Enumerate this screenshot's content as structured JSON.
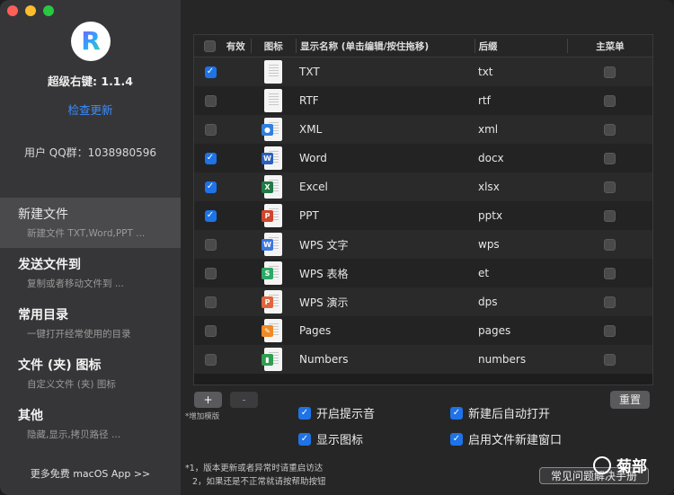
{
  "window": {
    "buttons": [
      "close",
      "minimize",
      "zoom"
    ]
  },
  "sidebar": {
    "logo_letter": "R",
    "app_version": "超级右键: 1.1.4",
    "check_update": "检查更新",
    "qq_group": "用户 QQ群：1038980596",
    "nav": [
      {
        "title": "新建文件",
        "subtitle": "新建文件 TXT,Word,PPT ...",
        "active": true
      },
      {
        "title": "发送文件到",
        "subtitle": "复制或者移动文件到 ...",
        "active": false
      },
      {
        "title": "常用目录",
        "subtitle": "一键打开经常使用的目录",
        "active": false
      },
      {
        "title": "文件 (夹) 图标",
        "subtitle": "自定义文件 (夹) 图标",
        "active": false
      },
      {
        "title": "其他",
        "subtitle": "隐藏,显示,拷贝路径 ...",
        "active": false
      }
    ],
    "more_apps": "更多免费 macOS App >>"
  },
  "table": {
    "headers": {
      "enabled": "有效",
      "icon": "图标",
      "name": "显示名称 (单击编辑/按住拖移)",
      "suffix": "后缀",
      "main_menu": "主菜单"
    },
    "rows": [
      {
        "enabled": true,
        "name": "TXT",
        "suffix": "txt",
        "icon": "txt-file-icon",
        "badge": "",
        "badge_color": ""
      },
      {
        "enabled": false,
        "name": "RTF",
        "suffix": "rtf",
        "icon": "rtf-file-icon",
        "badge": "",
        "badge_color": ""
      },
      {
        "enabled": false,
        "name": "XML",
        "suffix": "xml",
        "icon": "xml-file-icon",
        "badge": "●",
        "badge_color": "#2f7fe0"
      },
      {
        "enabled": true,
        "name": "Word",
        "suffix": "docx",
        "icon": "word-file-icon",
        "badge": "W",
        "badge_color": "#2b5fbf"
      },
      {
        "enabled": true,
        "name": "Excel",
        "suffix": "xlsx",
        "icon": "excel-file-icon",
        "badge": "X",
        "badge_color": "#1f7a45"
      },
      {
        "enabled": true,
        "name": "PPT",
        "suffix": "pptx",
        "icon": "ppt-file-icon",
        "badge": "P",
        "badge_color": "#d0452c"
      },
      {
        "enabled": false,
        "name": "WPS 文字",
        "suffix": "wps",
        "icon": "wps-writer-icon",
        "badge": "W",
        "badge_color": "#3b77e0"
      },
      {
        "enabled": false,
        "name": "WPS 表格",
        "suffix": "et",
        "icon": "wps-sheet-icon",
        "badge": "S",
        "badge_color": "#2da866"
      },
      {
        "enabled": false,
        "name": "WPS 演示",
        "suffix": "dps",
        "icon": "wps-slides-icon",
        "badge": "P",
        "badge_color": "#e0653a"
      },
      {
        "enabled": false,
        "name": "Pages",
        "suffix": "pages",
        "icon": "pages-file-icon",
        "badge": "✎",
        "badge_color": "#f08a24"
      },
      {
        "enabled": false,
        "name": "Numbers",
        "suffix": "numbers",
        "icon": "numbers-file-icon",
        "badge": "▮",
        "badge_color": "#2f9e4f"
      }
    ]
  },
  "controls": {
    "add": "+",
    "remove": "-",
    "add_template": "*增加模版",
    "reset": "重置",
    "options": [
      {
        "label": "开启提示音",
        "checked": true
      },
      {
        "label": "新建后自动打开",
        "checked": true
      },
      {
        "label": "显示图标",
        "checked": true
      },
      {
        "label": "启用文件新建窗口",
        "checked": true
      }
    ],
    "note1": "*1，版本更新或者异常时请重启访达",
    "note2": "2，如果还是不正常就请按帮助按钮",
    "faq": "常见问题解决手册"
  },
  "watermark": "菊部",
  "colors": {
    "accent": "#1e73e8",
    "link": "#3b8cff"
  }
}
